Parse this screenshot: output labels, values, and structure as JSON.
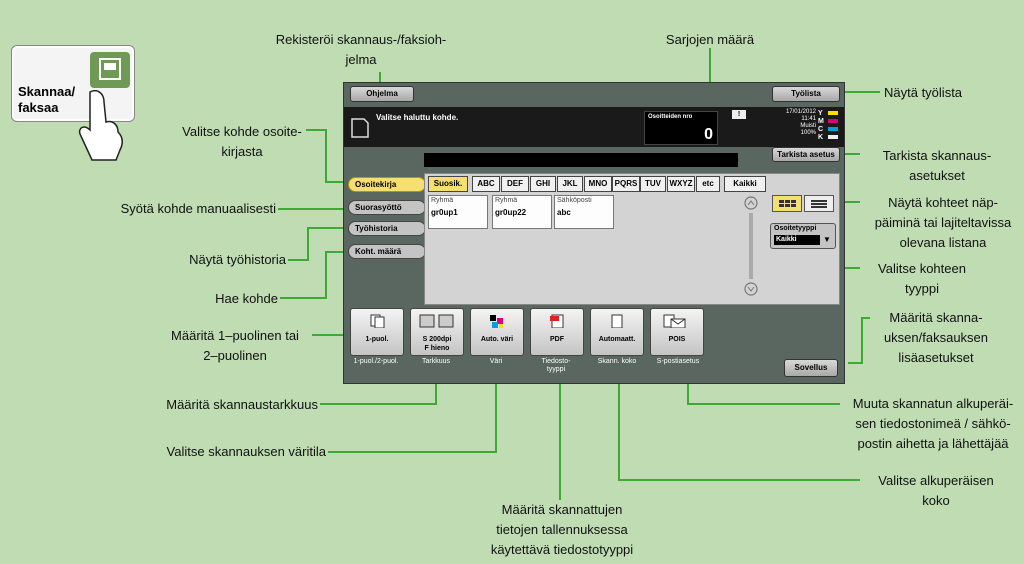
{
  "scan_button": {
    "label_line1": "Skannaa/",
    "label_line2": "faksaa"
  },
  "screen": {
    "top_left_button": "Ohjelma",
    "top_right_button": "Työlista",
    "message": "Valitse haluttu kohde.",
    "address_count_label": "Osoitteiden nro",
    "address_count_value": "0",
    "date": "17/01/2012",
    "time": "11:41",
    "memory_label": "Muisti",
    "memory_value": "100%",
    "toner": [
      "Y",
      "M",
      "C",
      "K"
    ],
    "check_settings_button": "Tarkista asetus",
    "tabs": [
      "Osoitekirja",
      "Suorasyöttö",
      "Työhistoria",
      "Koht. määrä"
    ],
    "index_keys": [
      "Suosik.",
      "ABC",
      "DEF",
      "GHI",
      "JKL",
      "MNO",
      "PQRS",
      "TUV",
      "WXYZ",
      "etc",
      "Kaikki"
    ],
    "destinations": [
      {
        "type": "Ryhmä",
        "name": "gr0up1"
      },
      {
        "type": "Ryhmä",
        "name": "gr0up22"
      },
      {
        "type": "Sähköposti",
        "name": "abc"
      }
    ],
    "address_type_label": "Osoitetyyppi",
    "address_type_value": "Kaikki",
    "functions": [
      {
        "text1": "1-puol.",
        "text2": "",
        "caption1": "1-puol./2-puol.",
        "caption2": ""
      },
      {
        "text1": "S 200dpi",
        "text2": "F hieno",
        "caption1": "Tarkkuus",
        "caption2": ""
      },
      {
        "text1": "Auto. väri",
        "text2": "",
        "caption1": "Väri",
        "caption2": ""
      },
      {
        "text1": "PDF",
        "text2": "",
        "caption1": "Tiedosto-",
        "caption2": "tyyppi"
      },
      {
        "text1": "Automaatt.",
        "text2": "",
        "caption1": "Skann. koko",
        "caption2": ""
      },
      {
        "text1": "POIS",
        "text2": "",
        "caption1": "S-postiasetus",
        "caption2": ""
      }
    ],
    "apply_button": "Sovellus"
  },
  "callouts": {
    "register_program": [
      "Rekisteröi skannaus-/faksioh-",
      "jelma"
    ],
    "set_count": [
      "Sarjojen määrä"
    ],
    "show_job_list": [
      "Näytä työlista"
    ],
    "select_from_addressbook": [
      "Valitse kohde osoite-",
      "kirjasta"
    ],
    "check_scan_settings": [
      "Tarkista skannaus-",
      "asetukset"
    ],
    "manual_input": [
      "Syötä kohde manuaalisesti"
    ],
    "show_as_buttons_or_list": [
      "Näytä kohteet näp-",
      "päiminä tai lajiteltavissa",
      "olevana listana"
    ],
    "show_job_history": [
      "Näytä työhistoria"
    ],
    "select_target_type": [
      "Valitse kohteen",
      "tyyppi"
    ],
    "search_target": [
      "Hae kohde"
    ],
    "define_sides": [
      "Määritä 1–puolinen tai",
      "2–puolinen"
    ],
    "additional_settings": [
      "Määritä skanna-",
      "uksen/faksauksen",
      "lisäasetukset"
    ],
    "define_resolution": [
      "Määritä skannaustarkkuus"
    ],
    "change_filename": [
      "Muuta skannatun alkuperäi-",
      "sen tiedostonimeä / sähkö-",
      "postin aihetta ja lähettäjää"
    ],
    "select_color_mode": [
      "Valitse skannauksen väritila"
    ],
    "select_original_size": [
      "Valitse alkuperäisen",
      "koko"
    ],
    "define_file_type": [
      "Määritä skannattujen",
      "tietojen tallennuksessa",
      "käytettävä tiedostotyyppi"
    ]
  },
  "colors": {
    "background": "#bfdcb3",
    "line": "#3ea935",
    "tab_selected": "#f4e071"
  }
}
